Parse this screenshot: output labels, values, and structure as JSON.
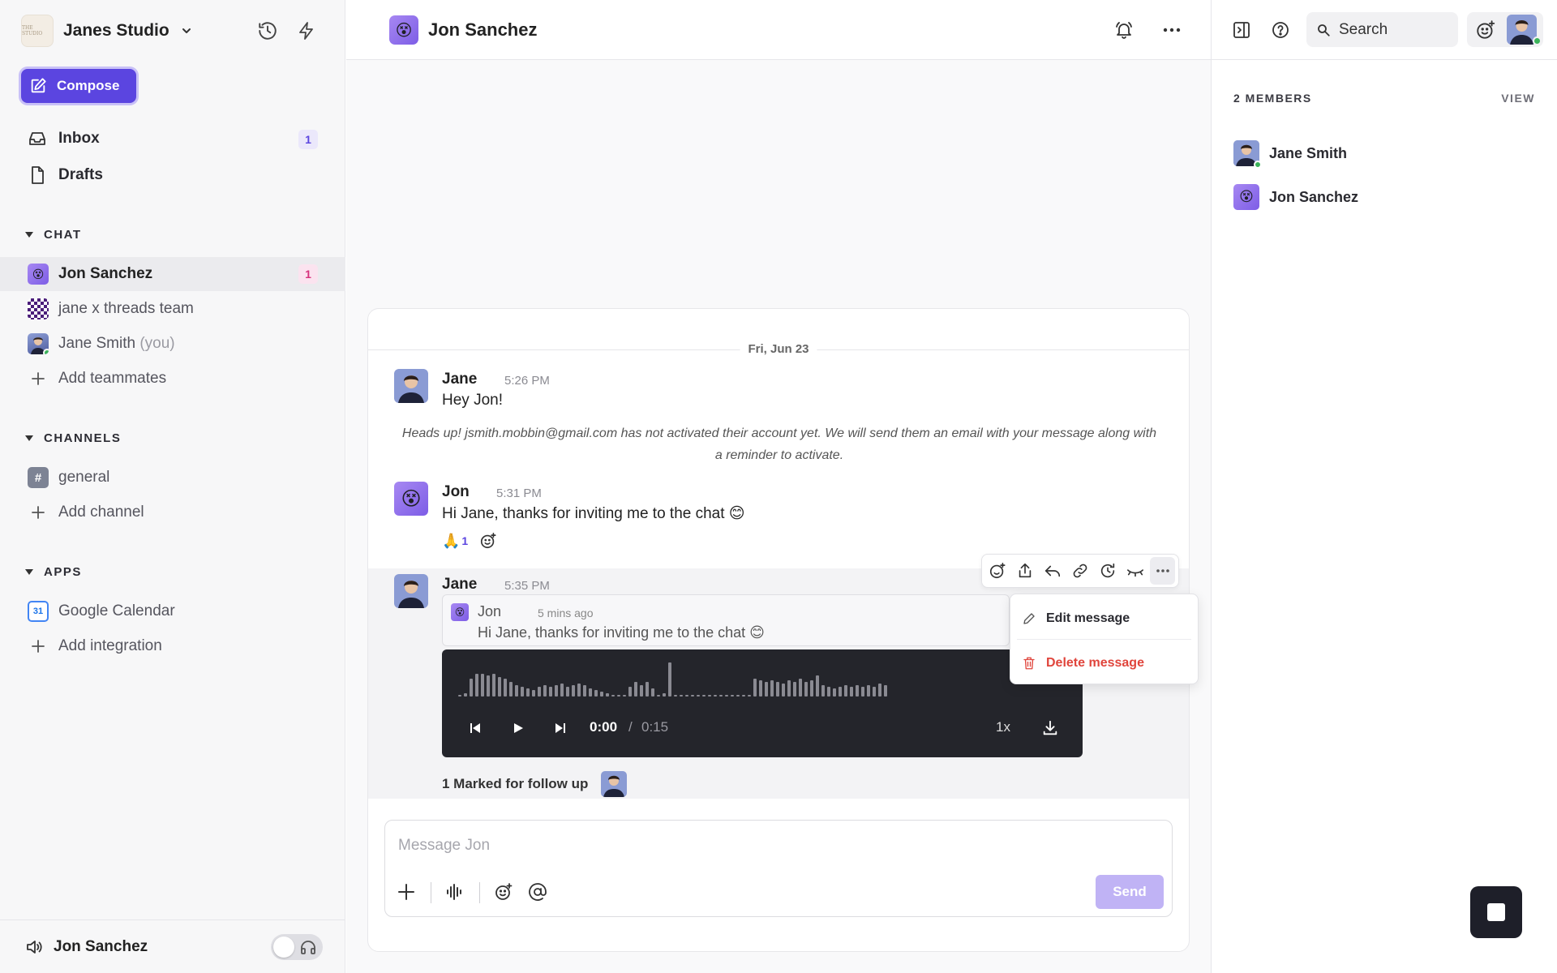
{
  "workspace": {
    "name": "Janes Studio",
    "logo_text": "THE STUDIO"
  },
  "sidebar": {
    "compose_label": "Compose",
    "nav": [
      {
        "label": "Inbox",
        "badge": "1"
      },
      {
        "label": "Drafts"
      }
    ],
    "chat_section": "CHAT",
    "chats": [
      {
        "label": "Jon Sanchez",
        "badge": "1"
      },
      {
        "label": "jane x threads team"
      },
      {
        "label": "Jane Smith",
        "suffix": "(you)"
      },
      {
        "label": "Add teammates"
      }
    ],
    "channels_section": "CHANNELS",
    "channels": [
      {
        "label": "general",
        "icon": "#"
      },
      {
        "label": "Add channel"
      }
    ],
    "apps_section": "APPS",
    "apps": [
      {
        "label": "Google Calendar",
        "icon": "31"
      },
      {
        "label": "Add integration"
      }
    ],
    "footer_name": "Jon Sanchez"
  },
  "main": {
    "title": "Jon Sanchez",
    "date_label": "Fri, Jun 23",
    "messages": [
      {
        "author": "Jane",
        "time": "5:26 PM",
        "text": "Hey Jon!"
      },
      {
        "author": "Jon",
        "time": "5:31 PM",
        "text": "Hi Jane, thanks for inviting me to the chat 😊"
      },
      {
        "author": "Jane",
        "time": "5:35 PM"
      }
    ],
    "notice": "Heads up! jsmith.mobbin@gmail.com has not activated their account yet. We will send them an email with your message along with a reminder to activate.",
    "reaction": {
      "emoji": "🙏",
      "count": "1"
    },
    "quote": {
      "author": "Jon",
      "time": "5 mins ago",
      "text": "Hi Jane, thanks for inviting me to the chat 😊"
    },
    "audio": {
      "current": "0:00",
      "separator": "/",
      "total": "0:15",
      "speed": "1x",
      "progress": 0
    },
    "followup_label": "1 Marked for follow up",
    "menu": {
      "edit": "Edit message",
      "delete": "Delete message"
    },
    "composer": {
      "placeholder": "Message Jon",
      "send_label": "Send"
    }
  },
  "right_panel": {
    "search_label": "Search",
    "members_title": "2 MEMBERS",
    "view_label": "VIEW",
    "members": [
      {
        "name": "Jane Smith"
      },
      {
        "name": "Jon Sanchez"
      }
    ]
  },
  "colors": {
    "accent": "#5b45e0",
    "delete": "#e0453c",
    "online": "#3bb35a",
    "badge_pink": "#d6337d"
  }
}
